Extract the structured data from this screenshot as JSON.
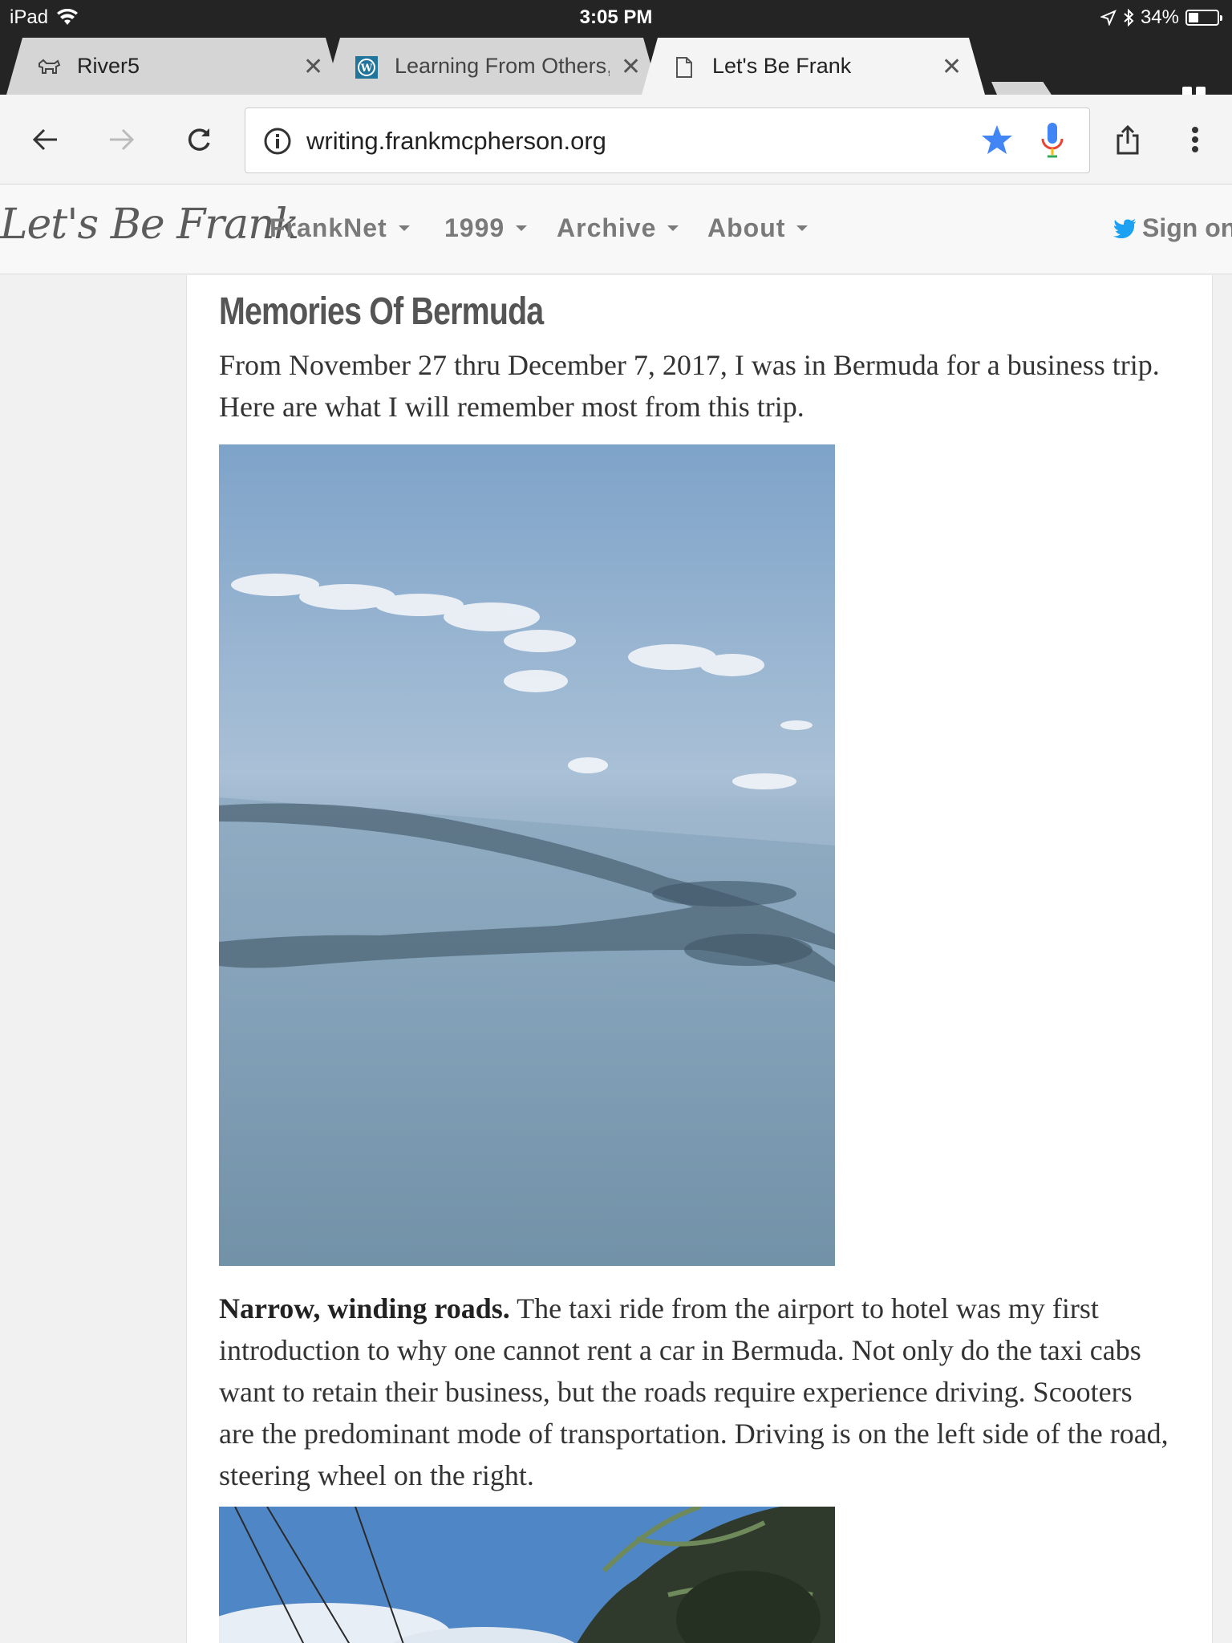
{
  "status": {
    "device": "iPad",
    "time": "3:05 PM",
    "battery": "34%",
    "battery_level": 0.34
  },
  "tabs": [
    {
      "title": "River5",
      "favicon": "dog-icon"
    },
    {
      "title": "Learning From Others,",
      "favicon": "wordpress-icon"
    },
    {
      "title": "Let's Be Frank",
      "favicon": "page-icon",
      "active": true
    }
  ],
  "omnibox": {
    "url": "writing.frankmcpherson.org",
    "bookmarked": true
  },
  "site": {
    "brand": "Let's Be Frank",
    "nav": [
      "FrankNet",
      "1999",
      "Archive",
      "About"
    ],
    "sign_on": "Sign on"
  },
  "article": {
    "title": "Memories Of Bermuda",
    "intro": "From November 27 thru December 7, 2017, I was in Bermuda for a business trip. Here are what I will remember most from this trip.",
    "para1_lead": "Narrow, winding roads.",
    "para1_body": " The taxi ride from the airport to hotel was my first introduction to why one cannot rent a car in Bermuda. Not only do the taxi cabs want to retain their business, but the roads require experience driving. Scooters are the predominant mode of transportation. Driving is on the left side of the road, steering wheel on the right."
  }
}
